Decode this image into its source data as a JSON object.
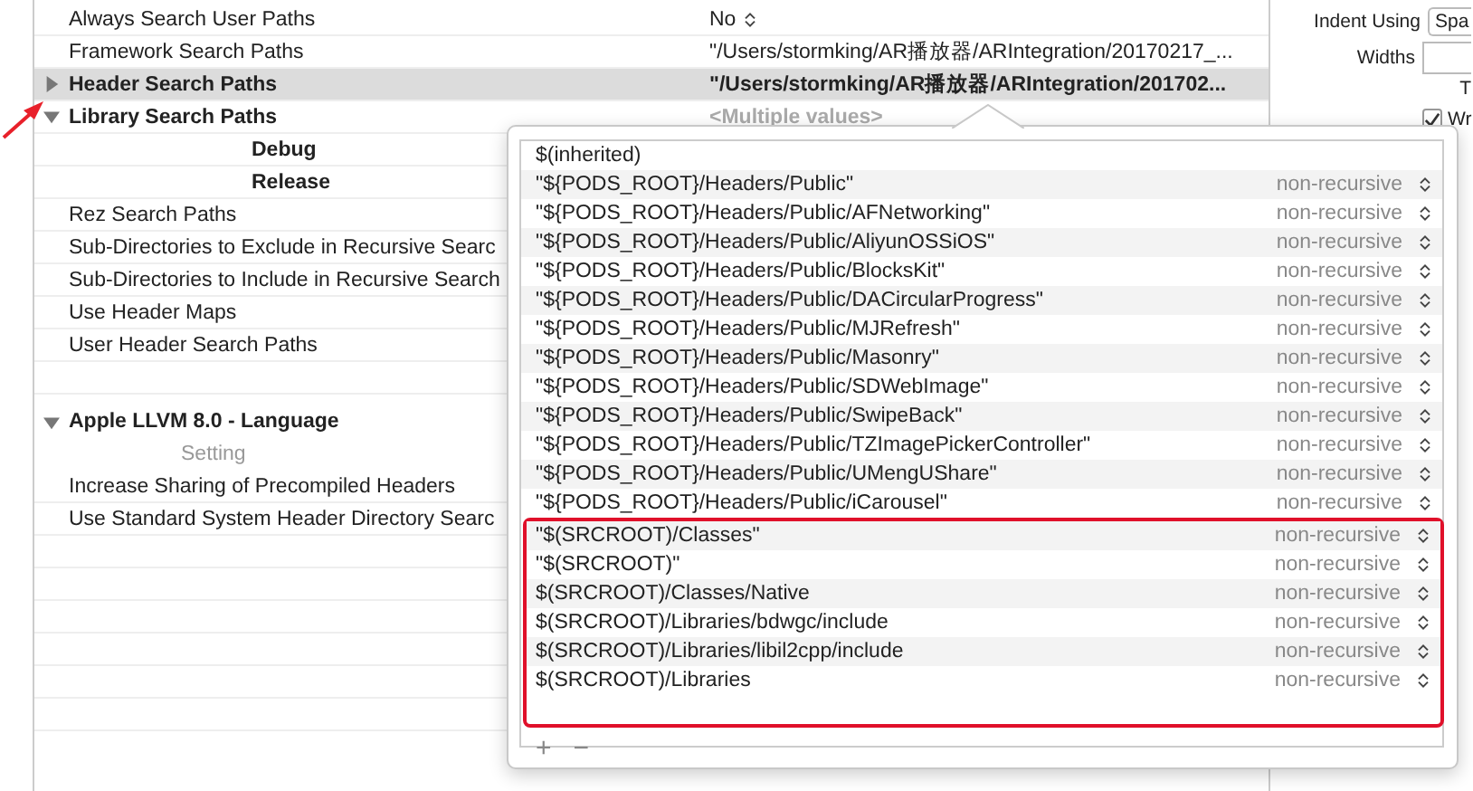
{
  "settings": [
    {
      "kind": "setting",
      "label": "Always Search User Paths",
      "value": "No",
      "popup": true,
      "selected": false
    },
    {
      "kind": "setting",
      "label": "Framework Search Paths",
      "value": "\"/Users/stormking/AR播放器/ARIntegration/20170217_...",
      "selected": false
    },
    {
      "kind": "setting",
      "label": "Header Search Paths",
      "value": "\"/Users/stormking/AR播放器/ARIntegration/201702...",
      "selected": true,
      "expanded": false,
      "bold": true
    },
    {
      "kind": "setting",
      "label": "Library Search Paths",
      "value": "<Multiple values>",
      "muted": true,
      "selected": false,
      "expanded": true,
      "bold": true
    },
    {
      "kind": "sub",
      "label": "Debug"
    },
    {
      "kind": "sub",
      "label": "Release"
    },
    {
      "kind": "setting",
      "label": "Rez Search Paths",
      "selected": false
    },
    {
      "kind": "setting",
      "label": "Sub-Directories to Exclude in Recursive Searc",
      "selected": false
    },
    {
      "kind": "setting",
      "label": "Sub-Directories to Include in Recursive Search",
      "selected": false
    },
    {
      "kind": "setting",
      "label": "Use Header Maps",
      "selected": false
    },
    {
      "kind": "setting",
      "label": "User Header Search Paths",
      "selected": false
    },
    {
      "kind": "blank"
    },
    {
      "kind": "section",
      "label": "Apple LLVM 8.0 - Language",
      "expanded": true
    },
    {
      "kind": "column_header",
      "label": "Setting"
    },
    {
      "kind": "setting",
      "label": "Increase Sharing of Precompiled Headers",
      "selected": false
    },
    {
      "kind": "setting",
      "label": "Use Standard System Header Directory Searc",
      "selected": false
    },
    {
      "kind": "blank"
    },
    {
      "kind": "blank"
    },
    {
      "kind": "blank"
    },
    {
      "kind": "blank"
    },
    {
      "kind": "blank"
    },
    {
      "kind": "blank"
    }
  ],
  "popover": {
    "entries": [
      {
        "path": "$(inherited)"
      },
      {
        "path": "\"${PODS_ROOT}/Headers/Public\"",
        "mode": "non-recursive"
      },
      {
        "path": "\"${PODS_ROOT}/Headers/Public/AFNetworking\"",
        "mode": "non-recursive"
      },
      {
        "path": "\"${PODS_ROOT}/Headers/Public/AliyunOSSiOS\"",
        "mode": "non-recursive"
      },
      {
        "path": "\"${PODS_ROOT}/Headers/Public/BlocksKit\"",
        "mode": "non-recursive"
      },
      {
        "path": "\"${PODS_ROOT}/Headers/Public/DACircularProgress\"",
        "mode": "non-recursive"
      },
      {
        "path": "\"${PODS_ROOT}/Headers/Public/MJRefresh\"",
        "mode": "non-recursive"
      },
      {
        "path": "\"${PODS_ROOT}/Headers/Public/Masonry\"",
        "mode": "non-recursive"
      },
      {
        "path": "\"${PODS_ROOT}/Headers/Public/SDWebImage\"",
        "mode": "non-recursive"
      },
      {
        "path": "\"${PODS_ROOT}/Headers/Public/SwipeBack\"",
        "mode": "non-recursive"
      },
      {
        "path": "\"${PODS_ROOT}/Headers/Public/TZImagePickerController\"",
        "mode": "non-recursive"
      },
      {
        "path": "\"${PODS_ROOT}/Headers/Public/UMengUShare\"",
        "mode": "non-recursive"
      },
      {
        "path": "\"${PODS_ROOT}/Headers/Public/iCarousel\"",
        "mode": "non-recursive"
      }
    ],
    "highlighted_entries": [
      {
        "path": "\"$(SRCROOT)/Classes\"",
        "mode": "non-recursive"
      },
      {
        "path": "\"$(SRCROOT)\"",
        "mode": "non-recursive"
      },
      {
        "path": "$(SRCROOT)/Classes/Native",
        "mode": "non-recursive"
      },
      {
        "path": "$(SRCROOT)/Libraries/bdwgc/include",
        "mode": "non-recursive"
      },
      {
        "path": "$(SRCROOT)/Libraries/libil2cpp/include",
        "mode": "non-recursive"
      },
      {
        "path": "$(SRCROOT)/Libraries",
        "mode": "non-recursive"
      }
    ],
    "add_label": "+",
    "remove_label": "−"
  },
  "inspector": {
    "indent_label": "Indent Using",
    "indent_value": "Spa",
    "widths_label": "Widths",
    "tab_label": "T",
    "wrap_label": "Wr",
    "wrap_checked": true
  }
}
